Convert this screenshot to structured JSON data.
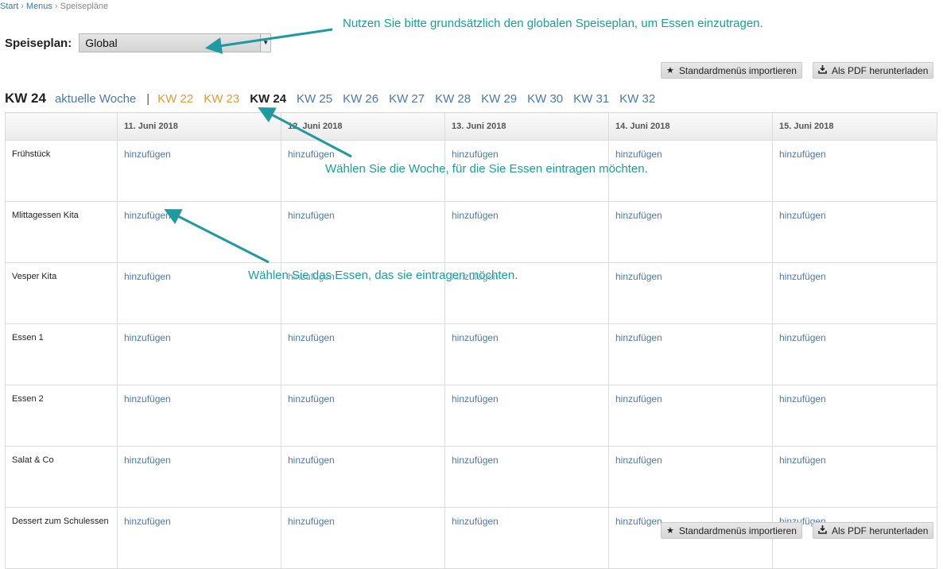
{
  "breadcrumb": {
    "start": "Start",
    "menus": "Menus",
    "current": "Speisepläne",
    "separator": "›"
  },
  "plan_selector": {
    "label": "Speiseplan:",
    "value": "Global",
    "arrow": "▼"
  },
  "buttons": {
    "import_label": "Standardmenüs importieren",
    "import_icon": "star-icon",
    "pdf_label": "Als PDF herunterladen",
    "pdf_icon": "download-icon"
  },
  "weeks": {
    "current_label": "KW 24",
    "this_week": "aktuelle Woche",
    "separator": "|",
    "items": [
      {
        "label": "KW 22",
        "state": "past"
      },
      {
        "label": "KW 23",
        "state": "past"
      },
      {
        "label": "KW 24",
        "state": "active"
      },
      {
        "label": "KW 25",
        "state": "future"
      },
      {
        "label": "KW 26",
        "state": "future"
      },
      {
        "label": "KW 27",
        "state": "future"
      },
      {
        "label": "KW 28",
        "state": "future"
      },
      {
        "label": "KW 29",
        "state": "future"
      },
      {
        "label": "KW 30",
        "state": "future"
      },
      {
        "label": "KW 31",
        "state": "future"
      },
      {
        "label": "KW 32",
        "state": "future"
      }
    ]
  },
  "table": {
    "days": [
      "11. Juni 2018",
      "12. Juni 2018",
      "13. Juni 2018",
      "14. Juni 2018",
      "15. Juni 2018"
    ],
    "meals": [
      "Frühstück",
      "Mlittagessen Kita",
      "Vesper Kita",
      "Essen 1",
      "Essen 2",
      "Salat & Co",
      "Dessert zum Schulessen"
    ],
    "cell_action": "hinzufügen"
  },
  "annotations": {
    "note_plan": "Nutzen Sie bitte grundsätzlich den globalen Speiseplan, um Essen einzutragen.",
    "note_week": "Wählen Sie die Woche, für die Sie Essen eintragen möchten.",
    "note_meal": "Wählen Sie das Essen, das sie eintragen möchten."
  },
  "colors": {
    "link": "#4a78b0",
    "past_week": "#e49a32",
    "annotation": "#15a19a"
  }
}
